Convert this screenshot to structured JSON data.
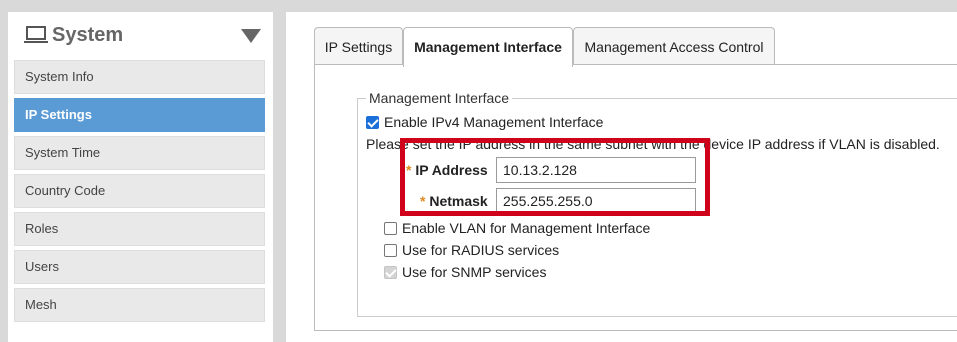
{
  "sidebar": {
    "title": "System",
    "icons": {
      "section": "laptop-icon",
      "collapse": "triangle-down-icon"
    },
    "items": [
      {
        "label": "System Info",
        "active": false
      },
      {
        "label": "IP Settings",
        "active": true
      },
      {
        "label": "System Time",
        "active": false
      },
      {
        "label": "Country Code",
        "active": false
      },
      {
        "label": "Roles",
        "active": false
      },
      {
        "label": "Users",
        "active": false
      },
      {
        "label": "Mesh",
        "active": false
      }
    ],
    "active_color": "#5b9bd5"
  },
  "tabs": [
    {
      "label": "IP Settings",
      "active": false
    },
    {
      "label": "Management Interface",
      "active": true
    },
    {
      "label": "Management Access Control",
      "active": false
    }
  ],
  "management": {
    "legend": "Management Interface",
    "enable_ipv4_label": "Enable IPv4 Management Interface",
    "enable_ipv4_checked": true,
    "note": "Please set the IP address in the same subnet with the device IP address if VLAN is disabled.",
    "ip_address": {
      "required_mark": "*",
      "label": "IP Address",
      "value": "10.13.2.128"
    },
    "netmask": {
      "required_mark": "*",
      "label": "Netmask",
      "value": "255.255.255.0"
    },
    "options": [
      {
        "label": "Enable VLAN for Management Interface",
        "checked": false,
        "disabled": false
      },
      {
        "label": "Use for RADIUS services",
        "checked": false,
        "disabled": false
      },
      {
        "label": "Use for SNMP services",
        "checked": true,
        "disabled": true
      }
    ],
    "highlight_color": "#d0021b"
  }
}
